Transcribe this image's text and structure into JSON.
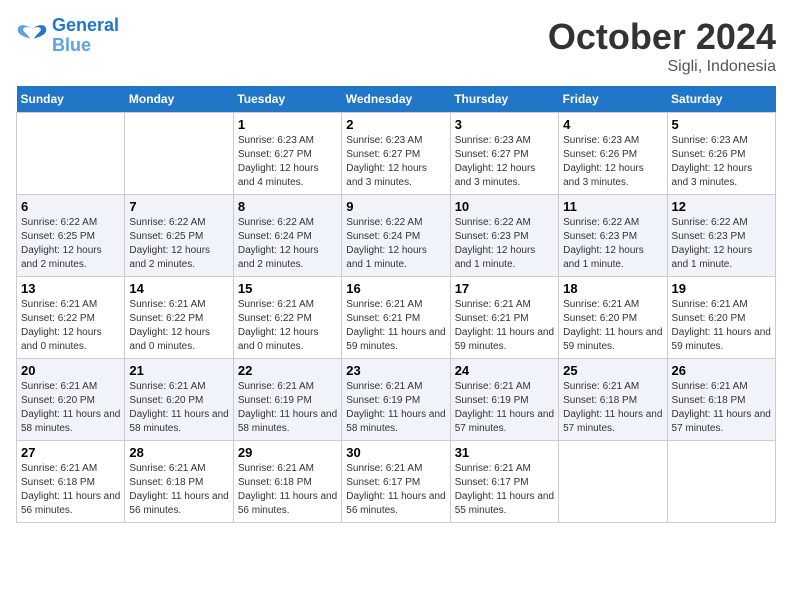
{
  "header": {
    "logo_line1": "General",
    "logo_line2": "Blue",
    "month": "October 2024",
    "location": "Sigli, Indonesia"
  },
  "days_of_week": [
    "Sunday",
    "Monday",
    "Tuesday",
    "Wednesday",
    "Thursday",
    "Friday",
    "Saturday"
  ],
  "weeks": [
    [
      {
        "day": "",
        "info": ""
      },
      {
        "day": "",
        "info": ""
      },
      {
        "day": "1",
        "info": "Sunrise: 6:23 AM\nSunset: 6:27 PM\nDaylight: 12 hours and 4 minutes."
      },
      {
        "day": "2",
        "info": "Sunrise: 6:23 AM\nSunset: 6:27 PM\nDaylight: 12 hours and 3 minutes."
      },
      {
        "day": "3",
        "info": "Sunrise: 6:23 AM\nSunset: 6:27 PM\nDaylight: 12 hours and 3 minutes."
      },
      {
        "day": "4",
        "info": "Sunrise: 6:23 AM\nSunset: 6:26 PM\nDaylight: 12 hours and 3 minutes."
      },
      {
        "day": "5",
        "info": "Sunrise: 6:23 AM\nSunset: 6:26 PM\nDaylight: 12 hours and 3 minutes."
      }
    ],
    [
      {
        "day": "6",
        "info": "Sunrise: 6:22 AM\nSunset: 6:25 PM\nDaylight: 12 hours and 2 minutes."
      },
      {
        "day": "7",
        "info": "Sunrise: 6:22 AM\nSunset: 6:25 PM\nDaylight: 12 hours and 2 minutes."
      },
      {
        "day": "8",
        "info": "Sunrise: 6:22 AM\nSunset: 6:24 PM\nDaylight: 12 hours and 2 minutes."
      },
      {
        "day": "9",
        "info": "Sunrise: 6:22 AM\nSunset: 6:24 PM\nDaylight: 12 hours and 1 minute."
      },
      {
        "day": "10",
        "info": "Sunrise: 6:22 AM\nSunset: 6:23 PM\nDaylight: 12 hours and 1 minute."
      },
      {
        "day": "11",
        "info": "Sunrise: 6:22 AM\nSunset: 6:23 PM\nDaylight: 12 hours and 1 minute."
      },
      {
        "day": "12",
        "info": "Sunrise: 6:22 AM\nSunset: 6:23 PM\nDaylight: 12 hours and 1 minute."
      }
    ],
    [
      {
        "day": "13",
        "info": "Sunrise: 6:21 AM\nSunset: 6:22 PM\nDaylight: 12 hours and 0 minutes."
      },
      {
        "day": "14",
        "info": "Sunrise: 6:21 AM\nSunset: 6:22 PM\nDaylight: 12 hours and 0 minutes."
      },
      {
        "day": "15",
        "info": "Sunrise: 6:21 AM\nSunset: 6:22 PM\nDaylight: 12 hours and 0 minutes."
      },
      {
        "day": "16",
        "info": "Sunrise: 6:21 AM\nSunset: 6:21 PM\nDaylight: 11 hours and 59 minutes."
      },
      {
        "day": "17",
        "info": "Sunrise: 6:21 AM\nSunset: 6:21 PM\nDaylight: 11 hours and 59 minutes."
      },
      {
        "day": "18",
        "info": "Sunrise: 6:21 AM\nSunset: 6:20 PM\nDaylight: 11 hours and 59 minutes."
      },
      {
        "day": "19",
        "info": "Sunrise: 6:21 AM\nSunset: 6:20 PM\nDaylight: 11 hours and 59 minutes."
      }
    ],
    [
      {
        "day": "20",
        "info": "Sunrise: 6:21 AM\nSunset: 6:20 PM\nDaylight: 11 hours and 58 minutes."
      },
      {
        "day": "21",
        "info": "Sunrise: 6:21 AM\nSunset: 6:20 PM\nDaylight: 11 hours and 58 minutes."
      },
      {
        "day": "22",
        "info": "Sunrise: 6:21 AM\nSunset: 6:19 PM\nDaylight: 11 hours and 58 minutes."
      },
      {
        "day": "23",
        "info": "Sunrise: 6:21 AM\nSunset: 6:19 PM\nDaylight: 11 hours and 58 minutes."
      },
      {
        "day": "24",
        "info": "Sunrise: 6:21 AM\nSunset: 6:19 PM\nDaylight: 11 hours and 57 minutes."
      },
      {
        "day": "25",
        "info": "Sunrise: 6:21 AM\nSunset: 6:18 PM\nDaylight: 11 hours and 57 minutes."
      },
      {
        "day": "26",
        "info": "Sunrise: 6:21 AM\nSunset: 6:18 PM\nDaylight: 11 hours and 57 minutes."
      }
    ],
    [
      {
        "day": "27",
        "info": "Sunrise: 6:21 AM\nSunset: 6:18 PM\nDaylight: 11 hours and 56 minutes."
      },
      {
        "day": "28",
        "info": "Sunrise: 6:21 AM\nSunset: 6:18 PM\nDaylight: 11 hours and 56 minutes."
      },
      {
        "day": "29",
        "info": "Sunrise: 6:21 AM\nSunset: 6:18 PM\nDaylight: 11 hours and 56 minutes."
      },
      {
        "day": "30",
        "info": "Sunrise: 6:21 AM\nSunset: 6:17 PM\nDaylight: 11 hours and 56 minutes."
      },
      {
        "day": "31",
        "info": "Sunrise: 6:21 AM\nSunset: 6:17 PM\nDaylight: 11 hours and 55 minutes."
      },
      {
        "day": "",
        "info": ""
      },
      {
        "day": "",
        "info": ""
      }
    ]
  ]
}
